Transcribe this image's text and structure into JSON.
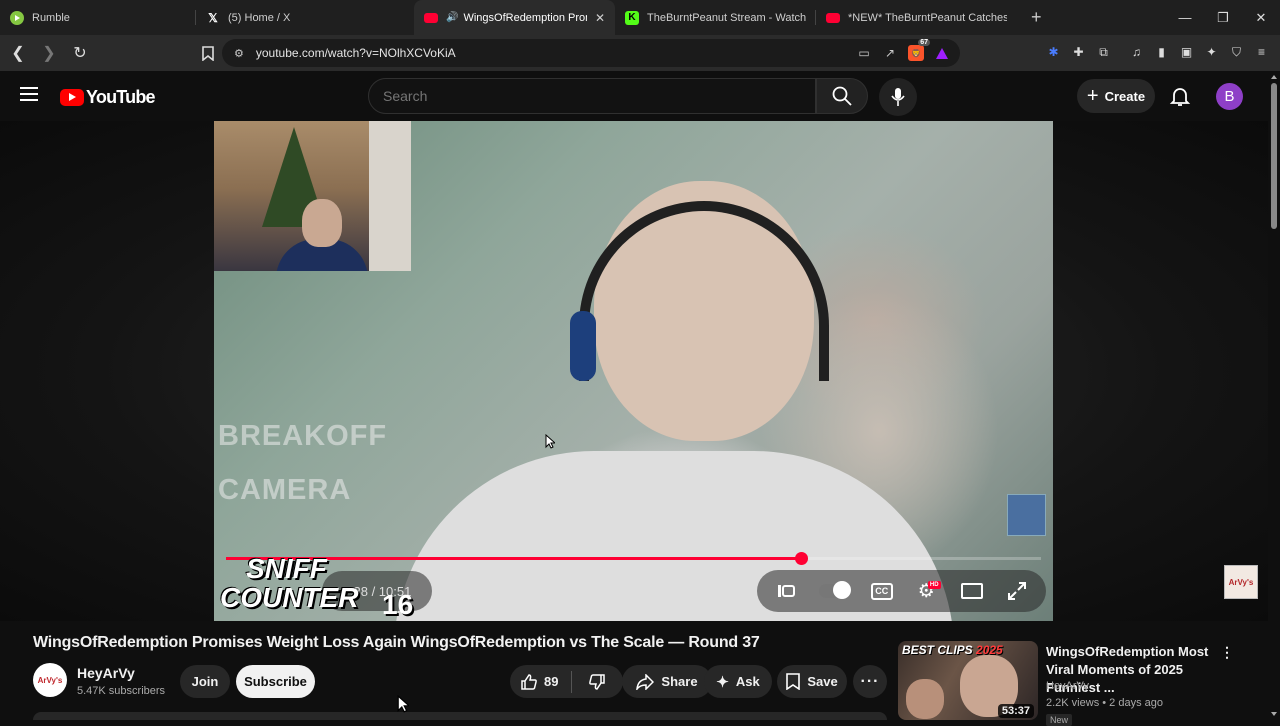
{
  "browser": {
    "tabs": [
      {
        "label": "Rumble",
        "active": false
      },
      {
        "label": "(5) Home / X",
        "active": false
      },
      {
        "label": "WingsOfRedemption Promise",
        "active": true
      },
      {
        "label": "TheBurntPeanut Stream - Watch Live",
        "active": false
      },
      {
        "label": "*NEW* TheBurntPeanut Catches Cloa",
        "active": false
      }
    ],
    "url": "youtube.com/watch?v=NOlhXCVoKiA",
    "brave_badge": "67"
  },
  "youtube": {
    "logo_text": "YouTube",
    "search_placeholder": "Search",
    "create_label": "Create",
    "avatar_letter": "B"
  },
  "player": {
    "overlay_text_1": "BREAKOFF",
    "overlay_text_2": "CAMERA",
    "sniff_line_1": "SNIFF",
    "sniff_line_2": "COUNTER",
    "sniff_count": "16",
    "time_display": "7:28 / 10:51",
    "progress_fraction": 0.705,
    "hd_badge": "HD"
  },
  "video": {
    "title": "WingsOfRedemption Promises Weight Loss Again WingsOfRedemption vs The Scale — Round 37",
    "channel_name": "HeyArVy",
    "channel_avatar_text": "ArVy's",
    "subscribers": "5.47K subscribers",
    "join_label": "Join",
    "subscribe_label": "Subscribe",
    "like_count": "89",
    "share_label": "Share",
    "ask_label": "Ask",
    "save_label": "Save"
  },
  "recommended": [
    {
      "title": "WingsOfRedemption Most Viral Moments of 2025 Funniest ...",
      "channel": "HeyArVy",
      "meta": "2.2K views • 2 days ago",
      "badge": "New",
      "duration": "53:37",
      "thumb_text": "BEST CLIPS",
      "thumb_year": "2025"
    }
  ],
  "colors": {
    "accent_red": "#ff0033",
    "avatar_purple": "#8e3fc7",
    "background": "#0f0f0f"
  }
}
